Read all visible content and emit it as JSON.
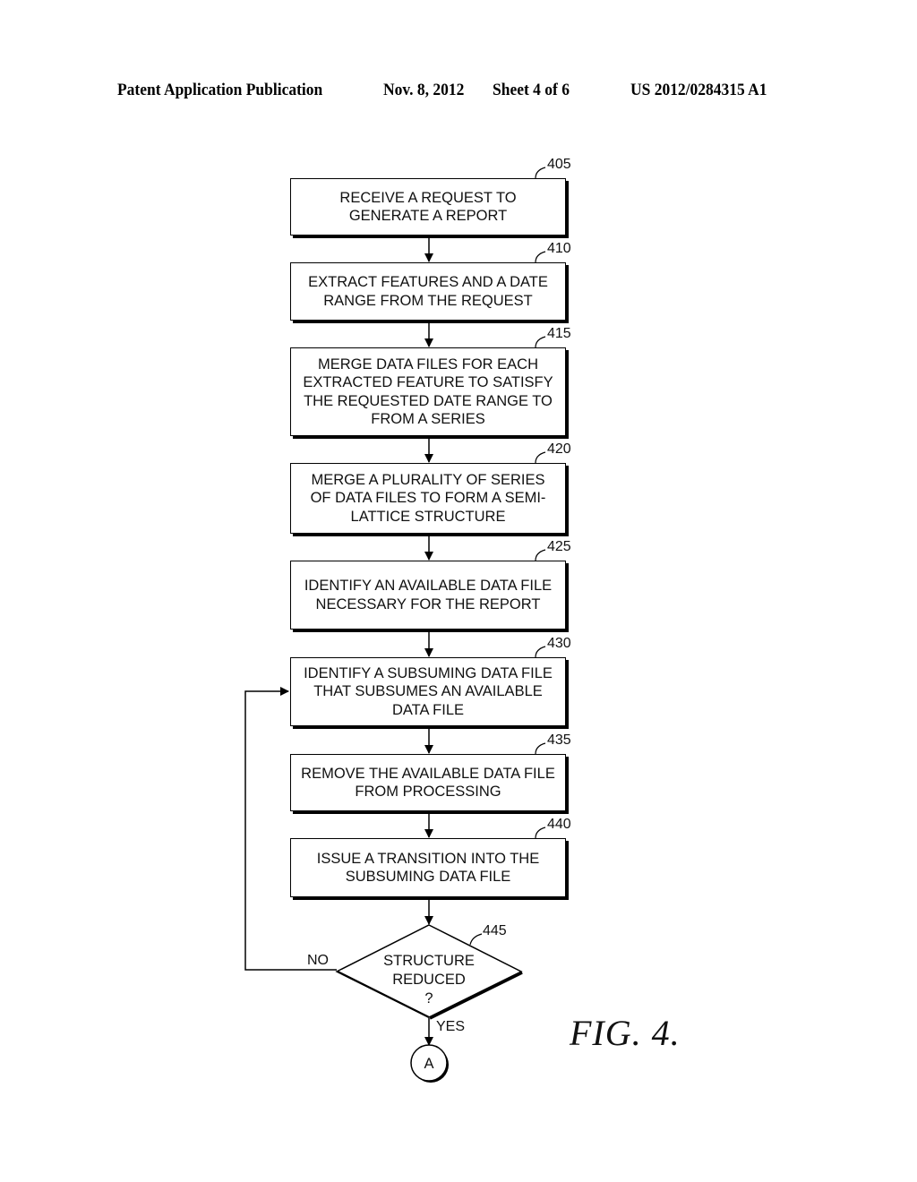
{
  "header": {
    "publication": "Patent Application Publication",
    "date": "Nov. 8, 2012",
    "sheet": "Sheet 4 of 6",
    "number": "US 2012/0284315 A1"
  },
  "steps": [
    {
      "ref": "405",
      "text": "RECEIVE A REQUEST TO GENERATE A REPORT"
    },
    {
      "ref": "410",
      "text": "EXTRACT FEATURES AND A DATE RANGE FROM THE REQUEST"
    },
    {
      "ref": "415",
      "text": "MERGE DATA FILES FOR EACH EXTRACTED FEATURE TO SATISFY THE REQUESTED DATE RANGE TO FROM A SERIES"
    },
    {
      "ref": "420",
      "text": "MERGE A PLURALITY OF SERIES OF DATA FILES TO FORM A SEMI-LATTICE STRUCTURE"
    },
    {
      "ref": "425",
      "text": "IDENTIFY AN AVAILABLE DATA FILE NECESSARY FOR THE REPORT"
    },
    {
      "ref": "430",
      "text": "IDENTIFY A SUBSUMING DATA FILE THAT SUBSUMES AN AVAILABLE DATA FILE"
    },
    {
      "ref": "435",
      "text": "REMOVE THE AVAILABLE DATA FILE FROM PROCESSING"
    },
    {
      "ref": "440",
      "text": "ISSUE A TRANSITION INTO THE SUBSUMING DATA FILE"
    }
  ],
  "decision": {
    "ref": "445",
    "lines": [
      "STRUCTURE",
      "REDUCED",
      "?"
    ],
    "no_label": "NO",
    "yes_label": "YES"
  },
  "connector": {
    "label": "A"
  },
  "figure_label": "FIG. 4."
}
